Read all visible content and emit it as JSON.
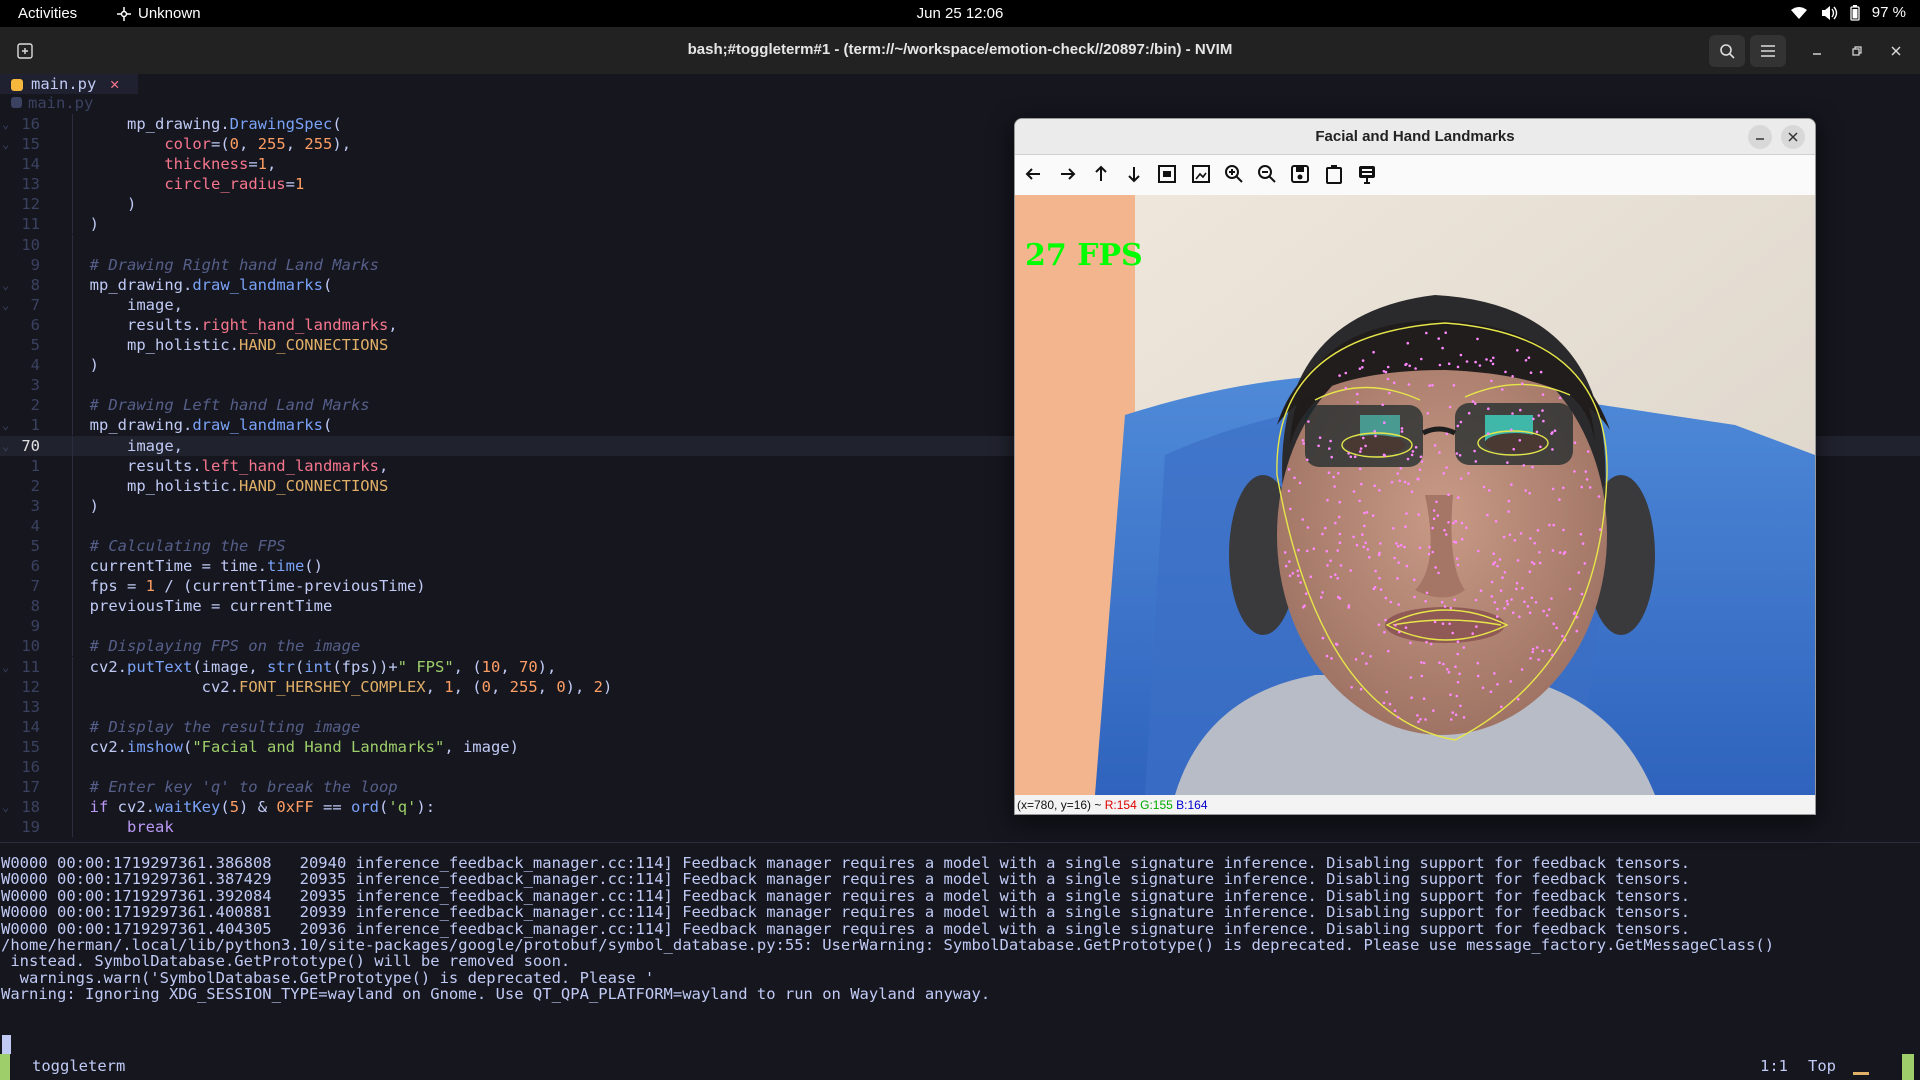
{
  "topbar": {
    "activities": "Activities",
    "app_name": "Unknown",
    "clock": "Jun 25  12:06",
    "battery": "97 %"
  },
  "window": {
    "title": "bash;#toggleterm#1 - (term://~/workspace/emotion-check//20897:/bin) - NVIM"
  },
  "editor": {
    "tab_name": "main.py",
    "tab_close": "✕",
    "winbar": "main.py",
    "lines": [
      {
        "fold": "⌄",
        "num": "16",
        "code": [
          [
            "      ",
            ""
          ],
          [
            "mp_drawing.",
            ""
          ],
          [
            "DrawingSpec",
            "fn"
          ],
          [
            "(",
            ""
          ]
        ]
      },
      {
        "fold": "⌄",
        "num": "15",
        "code": [
          [
            "          ",
            ""
          ],
          [
            "color",
            "attr"
          ],
          [
            "=(",
            ""
          ],
          [
            "0",
            "num2"
          ],
          [
            ", ",
            ""
          ],
          [
            "255",
            "num2"
          ],
          [
            ", ",
            ""
          ],
          [
            "255",
            "num2"
          ],
          [
            "),",
            ""
          ]
        ]
      },
      {
        "fold": "",
        "num": "14",
        "code": [
          [
            "          ",
            ""
          ],
          [
            "thickness",
            "attr"
          ],
          [
            "=",
            ""
          ],
          [
            "1",
            "num2"
          ],
          [
            ",",
            ""
          ]
        ]
      },
      {
        "fold": "",
        "num": "13",
        "code": [
          [
            "          ",
            ""
          ],
          [
            "circle_radius",
            "attr"
          ],
          [
            "=",
            ""
          ],
          [
            "1",
            "num2"
          ]
        ]
      },
      {
        "fold": "",
        "num": "12",
        "code": [
          [
            "      )",
            ""
          ]
        ]
      },
      {
        "fold": "",
        "num": "11",
        "code": [
          [
            "  )",
            ""
          ]
        ]
      },
      {
        "fold": "",
        "num": "10",
        "code": []
      },
      {
        "fold": "",
        "num": "9",
        "code": [
          [
            "  ",
            ""
          ],
          [
            "# Drawing Right hand Land Marks",
            "cmt"
          ]
        ]
      },
      {
        "fold": "⌄",
        "num": "8",
        "code": [
          [
            "  mp_drawing.",
            ""
          ],
          [
            "draw_landmarks",
            "fn"
          ],
          [
            "(",
            ""
          ]
        ]
      },
      {
        "fold": "⌄",
        "num": "7",
        "code": [
          [
            "      image,",
            ""
          ]
        ]
      },
      {
        "fold": "",
        "num": "6",
        "code": [
          [
            "      results.",
            ""
          ],
          [
            "right_hand_landmarks",
            "attr"
          ],
          [
            ",",
            ""
          ]
        ]
      },
      {
        "fold": "",
        "num": "5",
        "code": [
          [
            "      mp_holistic.",
            ""
          ],
          [
            "HAND_CONNECTIONS",
            "prm"
          ]
        ]
      },
      {
        "fold": "",
        "num": "4",
        "code": [
          [
            "  )",
            ""
          ]
        ]
      },
      {
        "fold": "",
        "num": "3",
        "code": []
      },
      {
        "fold": "",
        "num": "2",
        "code": [
          [
            "  ",
            ""
          ],
          [
            "# Drawing Left hand Land Marks",
            "cmt"
          ]
        ]
      },
      {
        "fold": "⌄",
        "num": "1",
        "code": [
          [
            "  mp_drawing.",
            ""
          ],
          [
            "draw_landmarks",
            "fn"
          ],
          [
            "(",
            ""
          ]
        ]
      },
      {
        "fold": "⌄",
        "num": "70",
        "cur": true,
        "code": [
          [
            "      image,",
            ""
          ]
        ]
      },
      {
        "fold": "",
        "num": "1",
        "code": [
          [
            "      results.",
            ""
          ],
          [
            "left_hand_landmarks",
            "attr"
          ],
          [
            ",",
            ""
          ]
        ]
      },
      {
        "fold": "",
        "num": "2",
        "code": [
          [
            "      mp_holistic.",
            ""
          ],
          [
            "HAND_CONNECTIONS",
            "prm"
          ]
        ]
      },
      {
        "fold": "",
        "num": "3",
        "code": [
          [
            "  )",
            ""
          ]
        ]
      },
      {
        "fold": "",
        "num": "4",
        "code": []
      },
      {
        "fold": "",
        "num": "5",
        "code": [
          [
            "  ",
            ""
          ],
          [
            "# Calculating the FPS",
            "cmt"
          ]
        ]
      },
      {
        "fold": "",
        "num": "6",
        "code": [
          [
            "  currentTime = time.",
            ""
          ],
          [
            "time",
            "fn"
          ],
          [
            "()",
            ""
          ]
        ]
      },
      {
        "fold": "",
        "num": "7",
        "code": [
          [
            "  fps = ",
            ""
          ],
          [
            "1",
            "num2"
          ],
          [
            " / (currentTime-previousTime)",
            ""
          ]
        ]
      },
      {
        "fold": "",
        "num": "8",
        "code": [
          [
            "  previousTime = currentTime",
            ""
          ]
        ]
      },
      {
        "fold": "",
        "num": "9",
        "code": []
      },
      {
        "fold": "",
        "num": "10",
        "code": [
          [
            "  ",
            ""
          ],
          [
            "# Displaying FPS on the image",
            "cmt"
          ]
        ]
      },
      {
        "fold": "⌄",
        "num": "11",
        "code": [
          [
            "  cv2.",
            ""
          ],
          [
            "putText",
            "fn"
          ],
          [
            "(image, ",
            ""
          ],
          [
            "str",
            "fn"
          ],
          [
            "(",
            ""
          ],
          [
            "int",
            "fn"
          ],
          [
            "(fps))+",
            ""
          ],
          [
            "\" FPS\"",
            "str"
          ],
          [
            ", (",
            ""
          ],
          [
            "10",
            "num2"
          ],
          [
            ", ",
            ""
          ],
          [
            "70",
            "num2"
          ],
          [
            "),",
            ""
          ]
        ]
      },
      {
        "fold": "",
        "num": "12",
        "code": [
          [
            "              cv2.",
            ""
          ],
          [
            "FONT_HERSHEY_COMPLEX",
            "prm"
          ],
          [
            ", ",
            ""
          ],
          [
            "1",
            "num2"
          ],
          [
            ", (",
            ""
          ],
          [
            "0",
            "num2"
          ],
          [
            ", ",
            ""
          ],
          [
            "255",
            "num2"
          ],
          [
            ", ",
            ""
          ],
          [
            "0",
            "num2"
          ],
          [
            "), ",
            ""
          ],
          [
            "2",
            "num2"
          ],
          [
            ")",
            ""
          ]
        ]
      },
      {
        "fold": "",
        "num": "13",
        "code": []
      },
      {
        "fold": "",
        "num": "14",
        "code": [
          [
            "  ",
            ""
          ],
          [
            "# Display the resulting image",
            "cmt"
          ]
        ]
      },
      {
        "fold": "",
        "num": "15",
        "code": [
          [
            "  cv2.",
            ""
          ],
          [
            "imshow",
            "fn"
          ],
          [
            "(",
            ""
          ],
          [
            "\"Facial and Hand Landmarks\"",
            "str"
          ],
          [
            ", image)",
            ""
          ]
        ]
      },
      {
        "fold": "",
        "num": "16",
        "code": []
      },
      {
        "fold": "",
        "num": "17",
        "code": [
          [
            "  ",
            ""
          ],
          [
            "# Enter key 'q' to break the loop",
            "cmt"
          ]
        ]
      },
      {
        "fold": "⌄",
        "num": "18",
        "code": [
          [
            "  ",
            ""
          ],
          [
            "if",
            "kw"
          ],
          [
            " cv2.",
            ""
          ],
          [
            "waitKey",
            "fn"
          ],
          [
            "(",
            ""
          ],
          [
            "5",
            "num2"
          ],
          [
            ") & ",
            ""
          ],
          [
            "0xFF",
            "num2"
          ],
          [
            " == ",
            ""
          ],
          [
            "ord",
            "fn"
          ],
          [
            "(",
            ""
          ],
          [
            "'q'",
            "str"
          ],
          [
            "):",
            ""
          ]
        ]
      },
      {
        "fold": "",
        "num": "19",
        "code": [
          [
            "      ",
            ""
          ],
          [
            "break",
            "kw"
          ]
        ]
      }
    ]
  },
  "terminal": {
    "lines": [
      "W0000 00:00:1719297361.386808   20940 inference_feedback_manager.cc:114] Feedback manager requires a model with a single signature inference. Disabling support for feedback tensors.",
      "W0000 00:00:1719297361.387429   20935 inference_feedback_manager.cc:114] Feedback manager requires a model with a single signature inference. Disabling support for feedback tensors.",
      "W0000 00:00:1719297361.392084   20935 inference_feedback_manager.cc:114] Feedback manager requires a model with a single signature inference. Disabling support for feedback tensors.",
      "W0000 00:00:1719297361.400881   20939 inference_feedback_manager.cc:114] Feedback manager requires a model with a single signature inference. Disabling support for feedback tensors.",
      "W0000 00:00:1719297361.404305   20936 inference_feedback_manager.cc:114] Feedback manager requires a model with a single signature inference. Disabling support for feedback tensors.",
      "/home/herman/.local/lib/python3.10/site-packages/google/protobuf/symbol_database.py:55: UserWarning: SymbolDatabase.GetPrototype() is deprecated. Please use message_factory.GetMessageClass()",
      " instead. SymbolDatabase.GetPrototype() will be removed soon.",
      "  warnings.warn('SymbolDatabase.GetPrototype() is deprecated. Please '",
      "Warning: Ignoring XDG_SESSION_TYPE=wayland on Gnome. Use QT_QPA_PLATFORM=wayland to run on Wayland anyway."
    ]
  },
  "status": {
    "name": "toggleterm",
    "position": "1:1",
    "scroll": "Top"
  },
  "cv_window": {
    "title": "Facial and Hand Landmarks",
    "fps_label": "27 FPS",
    "coords": "(x=780, y=16) ~ ",
    "r": "R:154",
    "g": "G:155",
    "b": "B:164",
    "tool_icons": [
      "pan-left-icon",
      "pan-right-icon",
      "pan-up-icon",
      "pan-down-icon",
      "zoom-fit-icon",
      "zoom-original-icon",
      "zoom-in-icon",
      "zoom-out-icon",
      "save-icon",
      "copy-icon",
      "properties-icon"
    ]
  },
  "colors": {
    "bg": "#15161e",
    "fps_text": "#00ff00",
    "landmark": "#ff88ff",
    "contour": "#e6e64a"
  }
}
